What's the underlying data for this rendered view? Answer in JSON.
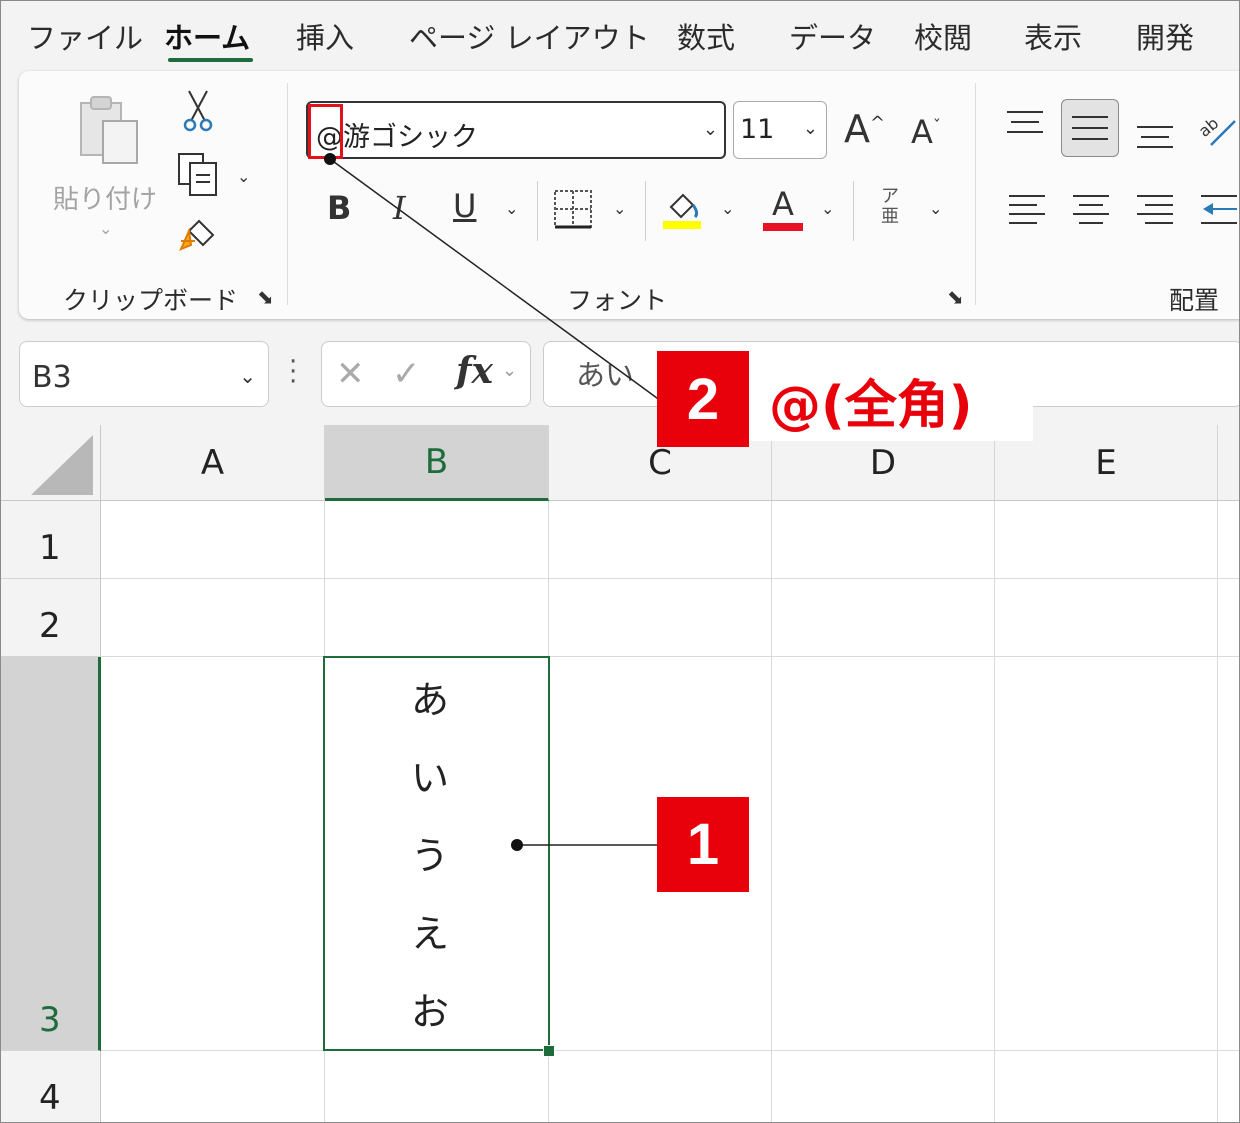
{
  "menu_tabs": [
    "ファイル",
    "ホーム",
    "挿入",
    "ページ レイアウト",
    "数式",
    "データ",
    "校閲",
    "表示",
    "開発"
  ],
  "ribbon": {
    "paste_label": "貼り付け",
    "clipboard_label": "クリップボード",
    "font_group_label": "フォント",
    "align_group_label": "配置",
    "font_name": "@游ゴシック",
    "font_size": "11",
    "bold": "B",
    "italic": "I",
    "underline": "U",
    "increase_font": "A",
    "decrease_font": "A",
    "font_color": "A",
    "phonetic_top": "ア",
    "phonetic_bottom": "亜",
    "highlight_color": "#ffff00",
    "font_color_bar": "#e81123"
  },
  "formula_bar": {
    "name_box": "B3",
    "formula": "あい",
    "fx": "fx"
  },
  "sheet": {
    "columns": [
      "A",
      "B",
      "C",
      "D",
      "E"
    ],
    "rows": [
      "1",
      "2",
      "3",
      "4"
    ],
    "active_cell": "B3",
    "cell_chars": [
      "あ",
      "い",
      "う",
      "え",
      "お"
    ]
  },
  "annotations": {
    "badge1": "1",
    "badge2": "2",
    "callout2": "@(全角)"
  }
}
